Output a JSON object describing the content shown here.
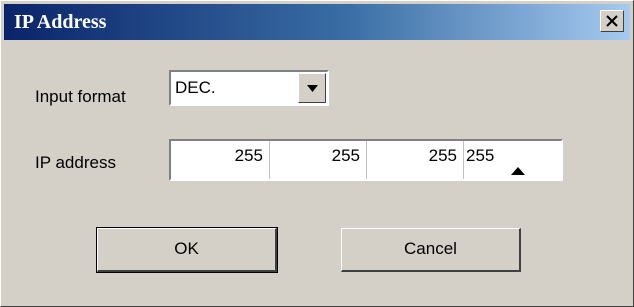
{
  "window": {
    "title": "IP Address",
    "close_glyph": "×"
  },
  "form": {
    "input_format_label": "Input format",
    "input_format_value": "DEC.",
    "ip_label": "IP address",
    "octets": [
      "255",
      "255",
      "255",
      "255"
    ]
  },
  "buttons": {
    "ok": "OK",
    "cancel": "Cancel"
  },
  "colors": {
    "title_bar_start": "#0a246a",
    "dialog_bg": "#d4d0c8"
  },
  "icons": {
    "close": "close-icon",
    "dropdown": "chevron-down-icon",
    "spin": "triangle-up-icon"
  }
}
